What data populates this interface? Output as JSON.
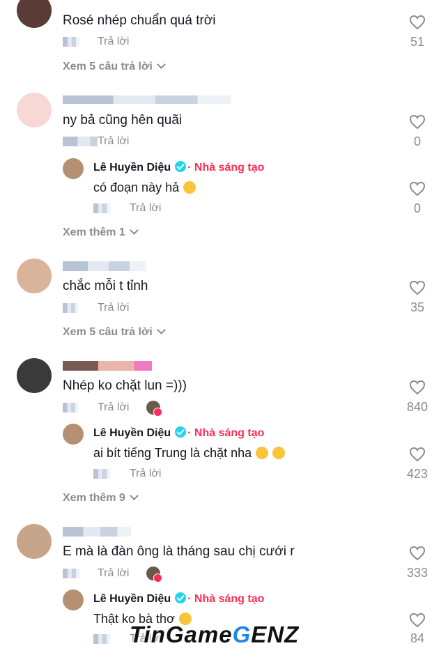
{
  "comments": [
    {
      "text": "Rosé nhép chuẩn quá trời",
      "reply_label": "Trả lời",
      "likes": "51",
      "view_replies": "Xem 5 câu trả lời"
    },
    {
      "text": "ny bả cũng hên quãi",
      "reply_label": "Trả lời",
      "likes": "0",
      "reply": {
        "author": "Lê Huyền Diệu",
        "badge": "· Nhà sáng tạo",
        "text": "có đoạn này hả",
        "reply_label": "Trả lời",
        "likes": "0"
      },
      "view_more": "Xem thêm 1"
    },
    {
      "text": "chắc mỗi t tỉnh",
      "reply_label": "Trả lời",
      "likes": "35",
      "view_replies": "Xem 5 câu trả lời"
    },
    {
      "text": "Nhép ko chặt lun =)))",
      "reply_label": "Trả lời",
      "likes": "840",
      "reply": {
        "author": "Lê Huyền Diệu",
        "badge": "· Nhà sáng tạo",
        "text": "ai bít tiếng Trung là chặt nha",
        "reply_label": "Trả lời",
        "likes": "423"
      },
      "view_more": "Xem thêm 9"
    },
    {
      "text": "E mà là đàn ông là tháng sau chị cưới r",
      "reply_label": "Trả lời",
      "likes": "333",
      "reply": {
        "author": "Lê Huyền Diệu",
        "badge": "· Nhà sáng tạo",
        "text": "Thật ko bà thơ",
        "reply_label": "Trả lời",
        "likes": "84"
      }
    }
  ],
  "watermark": {
    "part1": "TinGame",
    "part2": "G",
    "part3": "ENZ"
  },
  "colors": {
    "creator": "#fe2c55",
    "verified": "#20d5ec",
    "muted": "#8a8b91"
  }
}
